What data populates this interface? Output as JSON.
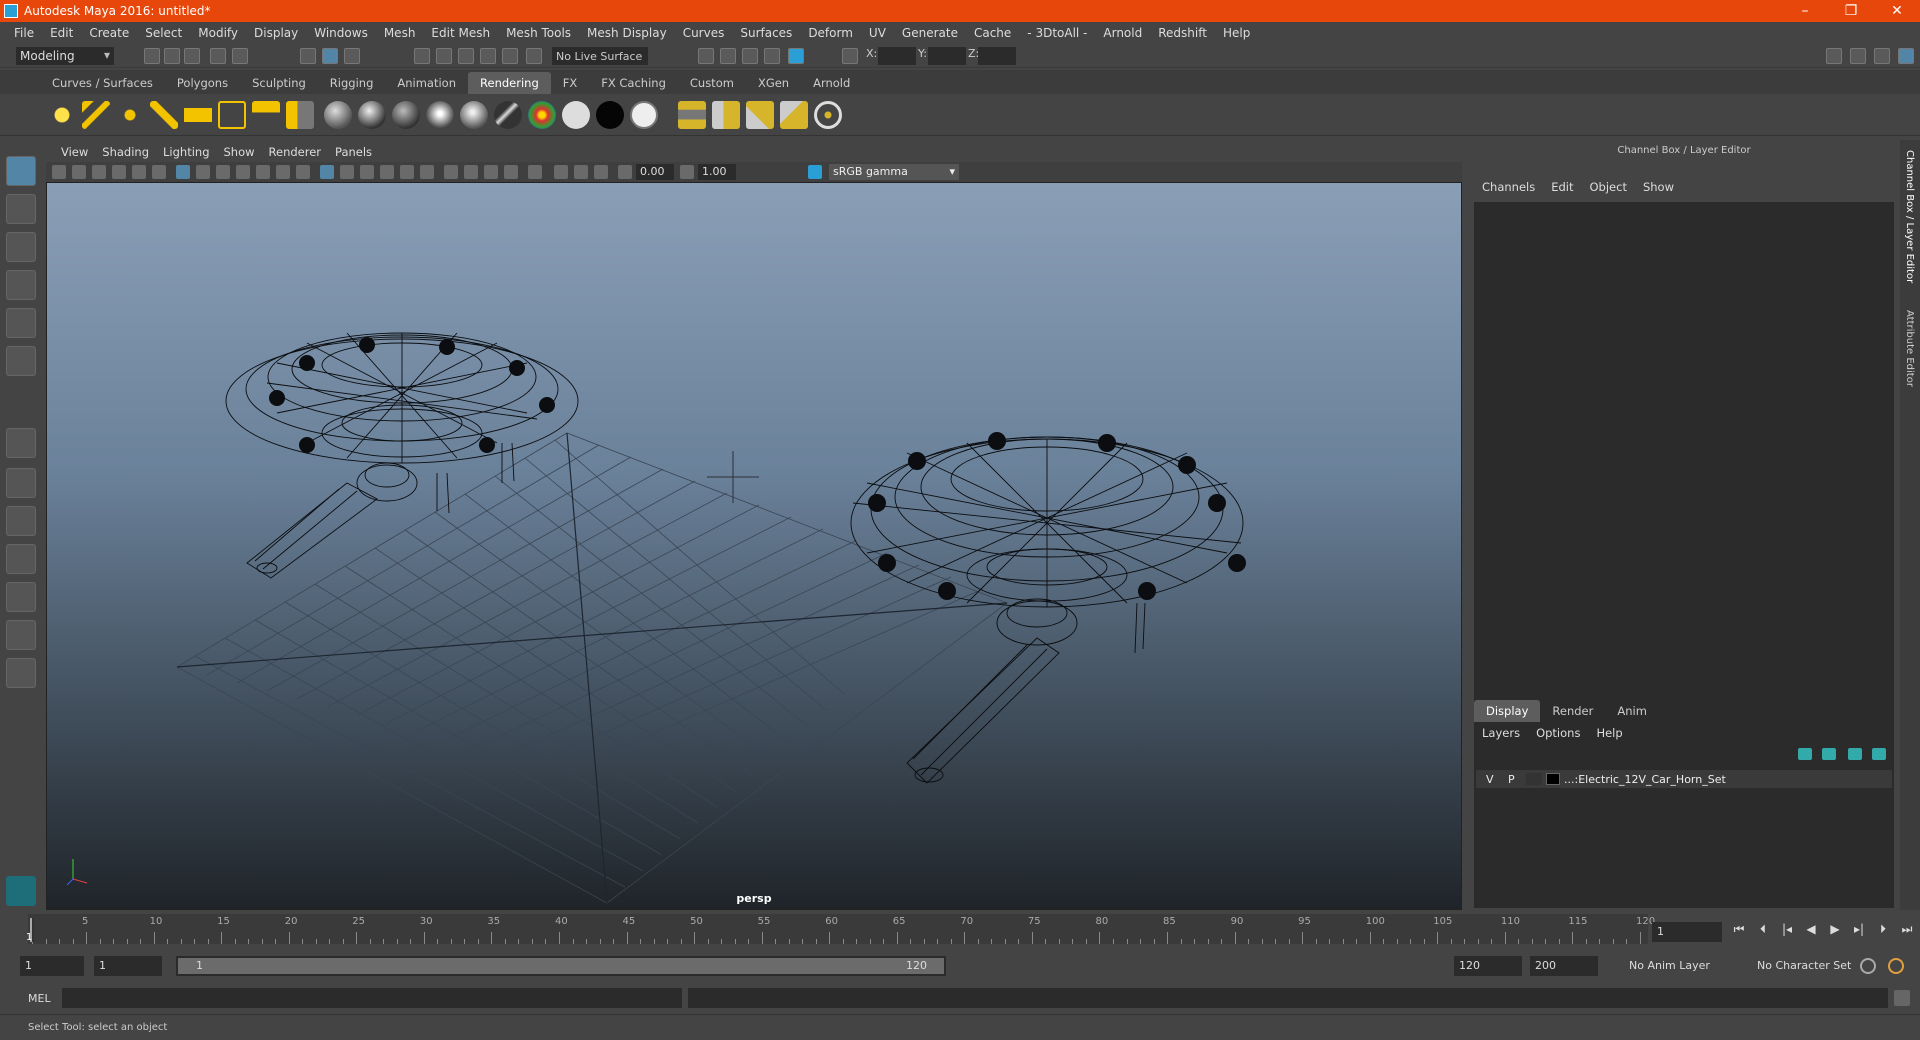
{
  "title": "Autodesk Maya 2016: untitled*",
  "window_buttons": [
    "–",
    "❐",
    "✕"
  ],
  "menu": [
    "File",
    "Edit",
    "Create",
    "Select",
    "Modify",
    "Display",
    "Windows",
    "Mesh",
    "Edit Mesh",
    "Mesh Tools",
    "Mesh Display",
    "Curves",
    "Surfaces",
    "Deform",
    "UV",
    "Generate",
    "Cache",
    "- 3DtoAll -",
    "Arnold",
    "Redshift",
    "Help"
  ],
  "status": {
    "mode": "Modeling",
    "live_surface": "No Live Surface",
    "x_label": "X:",
    "y_label": "Y:",
    "z_label": "Z:"
  },
  "shelf_tabs": [
    "Curves / Surfaces",
    "Polygons",
    "Sculpting",
    "Rigging",
    "Animation",
    "Rendering",
    "FX",
    "FX Caching",
    "Custom",
    "XGen",
    "Arnold"
  ],
  "shelf_active": "Rendering",
  "viewport_menu": [
    "View",
    "Shading",
    "Lighting",
    "Show",
    "Renderer",
    "Panels"
  ],
  "viewport_toolbar": {
    "exposure": "0.00",
    "gamma": "1.00",
    "color_space": "sRGB gamma"
  },
  "viewport_label": "persp",
  "right_panel": {
    "title": "Channel Box / Layer Editor",
    "menu": [
      "Channels",
      "Edit",
      "Object",
      "Show"
    ],
    "side_tabs": [
      "Channel Box / Layer Editor",
      "Attribute Editor"
    ]
  },
  "layer_tabs": [
    "Display",
    "Render",
    "Anim"
  ],
  "layer_active": "Display",
  "layer_menu": [
    "Layers",
    "Options",
    "Help"
  ],
  "layer": {
    "v": "V",
    "p": "P",
    "name": "...:Electric_12V_Car_Horn_Set"
  },
  "timeline": {
    "ticks": [
      "5",
      "10",
      "15",
      "20",
      "25",
      "30",
      "35",
      "40",
      "45",
      "50",
      "55",
      "60",
      "65",
      "70",
      "75",
      "80",
      "85",
      "90",
      "95",
      "100",
      "105",
      "110",
      "115",
      "120"
    ],
    "current": "1",
    "current_field": "1"
  },
  "range": {
    "start": "1",
    "playback_start": "1",
    "slider_start": "1",
    "slider_end": "120",
    "playback_end": "120",
    "end": "200",
    "anim_layer": "No Anim Layer",
    "character_set": "No Character Set"
  },
  "cmd": {
    "label": "MEL"
  },
  "help": "Select Tool: select an object"
}
